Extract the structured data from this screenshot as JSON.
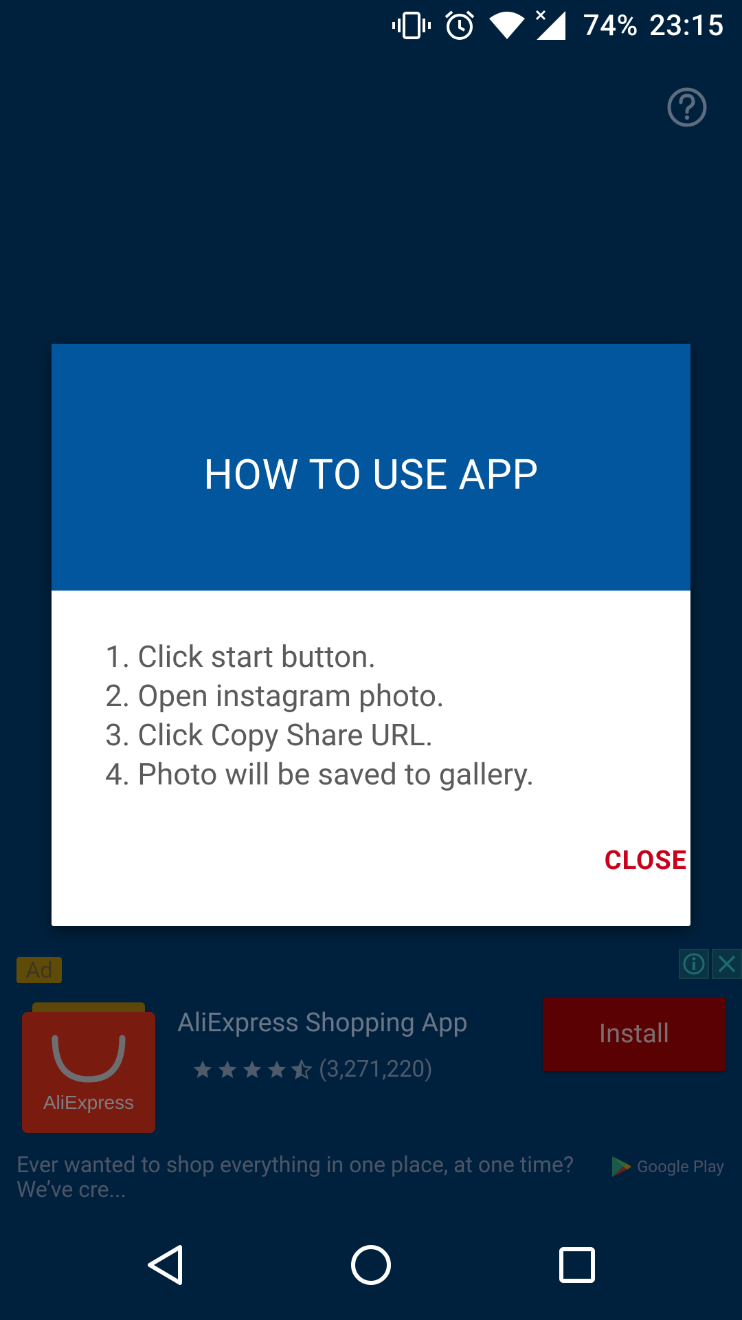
{
  "status_bar": {
    "battery": "74%",
    "time": "23:15",
    "icons": [
      "vibrate-icon",
      "alarm-icon",
      "wifi-icon",
      "signal-icon"
    ]
  },
  "toolbar": {
    "help_icon": "help-circle-icon"
  },
  "dialog": {
    "title": "HOW TO USE APP",
    "steps": [
      "1. Click start button.",
      "2. Open instagram photo.",
      "3. Click Copy Share URL.",
      "4. Photo will be saved to gallery."
    ],
    "close_label": "CLOSE"
  },
  "ad": {
    "badge": "Ad",
    "app_name": "AliExpress Shopping App",
    "logo_text": "AliExpress",
    "rating": 4.5,
    "rating_count": "(3,271,220)",
    "install_label": "Install",
    "description": "Ever wanted to shop everything in one place, at one time? We’ve cre...",
    "store": "Google Play"
  },
  "navbar": {
    "back": "back-icon",
    "home": "home-icon",
    "recents": "recents-icon"
  },
  "colors": {
    "background": "#00213e",
    "dialog_header": "#02569e",
    "close_text": "#c8001a",
    "install_button": "#5a0203"
  }
}
